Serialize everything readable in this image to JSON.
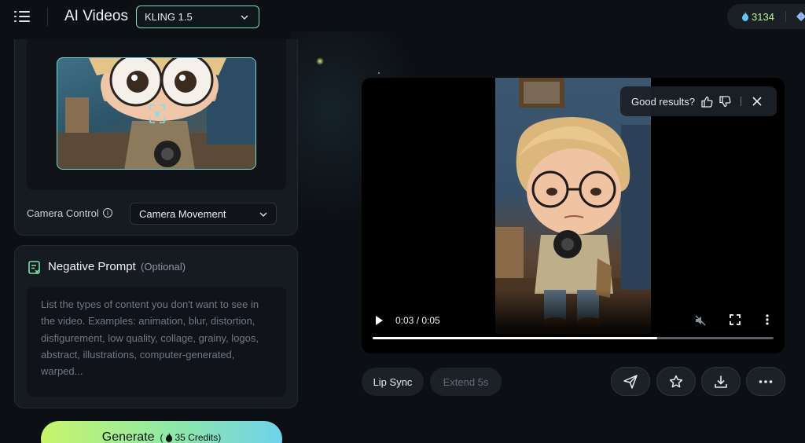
{
  "header": {
    "title": "AI Videos",
    "model": "KLING 1.5",
    "credits": "3134"
  },
  "camera": {
    "label": "Camera Control",
    "value": "Camera Movement"
  },
  "negative_prompt": {
    "title": "Negative Prompt",
    "optional": "(Optional)",
    "placeholder": "List the types of content you don't want to see in the video. Examples: animation, blur, distortion, disfigurement, low quality, collage, grainy, logos, abstract, illustrations, computer-generated, warped..."
  },
  "generate": {
    "label": "Generate",
    "cost": "35 Credits",
    "paren_open": "(",
    "paren_close": ")"
  },
  "video": {
    "time": "0:03 / 0:05",
    "progress": 0.71
  },
  "feedback": {
    "question": "Good results?"
  },
  "actions": {
    "lip_sync": "Lip Sync",
    "extend": "Extend 5s"
  },
  "colors": {
    "accent_green": "#7ee0a8",
    "credits_green": "#b6f39a",
    "thumb_border": "#7fd9d7"
  }
}
